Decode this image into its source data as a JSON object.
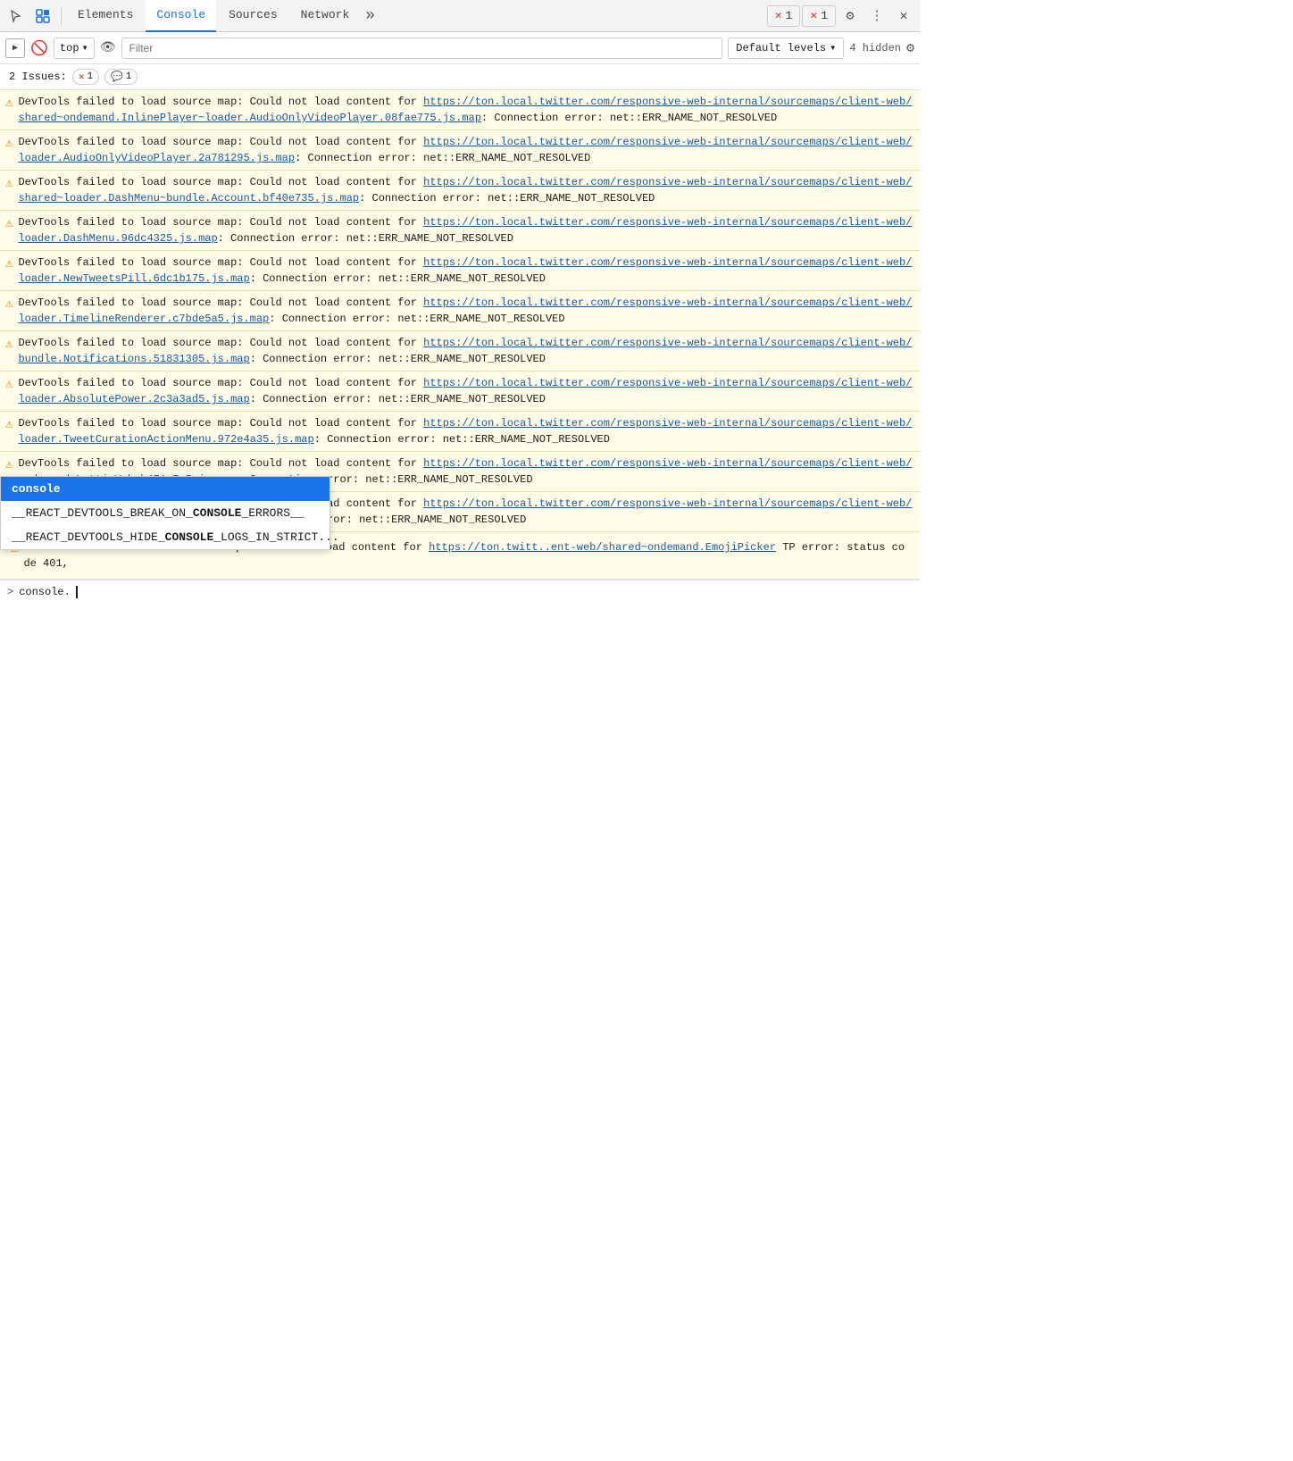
{
  "tabs": [
    {
      "label": "Elements",
      "active": false
    },
    {
      "label": "Console",
      "active": true
    },
    {
      "label": "Sources",
      "active": false
    },
    {
      "label": "Network",
      "active": false
    }
  ],
  "toolbar": {
    "top_selector": "top",
    "filter_placeholder": "Filter",
    "default_levels": "Default levels",
    "hidden_count": "4 hidden",
    "badge1_count": "1",
    "badge2_count": "1"
  },
  "issues": {
    "label": "2 Issues:",
    "error_count": "1",
    "info_count": "1"
  },
  "messages": [
    {
      "type": "warning",
      "text_prefix": "DevTools failed to load source map: Could not load content for ",
      "link": "https://ton.local.twitter.com/responsive-web-internal/sourcemaps/client-web/shared~ondemand.InlinePlayer~loader.AudioOnlyVideoPlayer.08fae775.js.map",
      "text_suffix": ": Connection error: net::ERR_NAME_NOT_RESOLVED"
    },
    {
      "type": "warning",
      "text_prefix": "DevTools failed to load source map: Could not load content for ",
      "link": "https://ton.local.twitter.com/responsive-web-internal/sourcemaps/client-web/loader.AudioOnlyVideoPlayer.2a781295.js.map",
      "text_suffix": ": Connection error: net::ERR_NAME_NOT_RESOLVED"
    },
    {
      "type": "warning",
      "text_prefix": "DevTools failed to load source map: Could not load content for ",
      "link": "https://ton.local.twitter.com/responsive-web-internal/sourcemaps/client-web/shared~loader.DashMenu~bundle.Account.bf40e735.js.map",
      "text_suffix": ": Connection error: net::ERR_NAME_NOT_RESOLVED"
    },
    {
      "type": "warning",
      "text_prefix": "DevTools failed to load source map: Could not load content for ",
      "link": "https://ton.local.twitter.com/responsive-web-internal/sourcemaps/client-web/loader.DashMenu.96dc4325.js.map",
      "text_suffix": ": Connection error: net::ERR_NAME_NOT_RESOLVED"
    },
    {
      "type": "warning",
      "text_prefix": "DevTools failed to load source map: Could not load content for ",
      "link": "https://ton.local.twitter.com/responsive-web-internal/sourcemaps/client-web/loader.NewTweetsPill.6dc1b175.js.map",
      "text_suffix": ": Connection error: net::ERR_NAME_NOT_RESOLVED"
    },
    {
      "type": "warning",
      "text_prefix": "DevTools failed to load source map: Could not load content for ",
      "link": "https://ton.local.twitter.com/responsive-web-internal/sourcemaps/client-web/loader.TimelineRenderer.c7bde5a5.js.map",
      "text_suffix": ": Connection error: net::ERR_NAME_NOT_RESOLVED"
    },
    {
      "type": "warning",
      "text_prefix": "DevTools failed to load source map: Could not load content for ",
      "link": "https://ton.local.twitter.com/responsive-web-internal/sourcemaps/client-web/bundle.Notifications.51831305.js.map",
      "text_suffix": ": Connection error: net::ERR_NAME_NOT_RESOLVED"
    },
    {
      "type": "warning",
      "text_prefix": "DevTools failed to load source map: Could not load content for ",
      "link": "https://ton.local.twitter.com/responsive-web-internal/sourcemaps/client-web/loader.AbsolutePower.2c3a3ad5.js.map",
      "text_suffix": ": Connection error: net::ERR_NAME_NOT_RESOLVED"
    },
    {
      "type": "warning",
      "text_prefix": "DevTools failed to load source map: Could not load content for ",
      "link": "https://ton.local.twitter.com/responsive-web-internal/sourcemaps/client-web/loader.TweetCurationActionMenu.972e4a35.js.map",
      "text_suffix": ": Connection error: net::ERR_NAME_NOT_RESOLVED"
    },
    {
      "type": "warning",
      "text_prefix": "DevTools failed to load source map: Could not load content for ",
      "link": "https://ton.local.twitter.com/responsive-web-internal/sourcemaps/client-web/ondemand.LottieWeb.b471e7e5.js.map",
      "text_suffix": ": Connection error: net::ERR_NAME_NOT_RESOLVED"
    },
    {
      "type": "warning",
      "text_prefix": "DevTools failed to load source map: Could not load content for ",
      "link": "https://ton.local.twitter.com/responsive-web-internal/sourcemaps/client-web/ondemand.emoji.en.928b7305.js.map",
      "text_suffix": ": Connection error: net::ERR_NAME_NOT_RESOLVED"
    },
    {
      "type": "warning",
      "text_prefix": "DevTools failed to load source map: Could not load content for ",
      "link": "https://ton.twitt..ent-web/shared~ondemand.EmojiPicker",
      "text_suffix": "TP error: status code 401,"
    }
  ],
  "autocomplete": {
    "selected": "console",
    "items": [
      {
        "text": "console",
        "selected": true,
        "bold_part": "console"
      },
      {
        "text": "__REACT_DEVTOOLS_BREAK_ON_CONSOLE_ERRORS__",
        "selected": false,
        "bold_part": "CONSOLE"
      },
      {
        "text": "__REACT_DEVTOOLS_HIDE_CONSOLE_LOGS_IN_STRICT...",
        "selected": false,
        "bold_part": "CONSOLE"
      }
    ]
  },
  "prompt": {
    "arrow": ">",
    "input": "console."
  }
}
